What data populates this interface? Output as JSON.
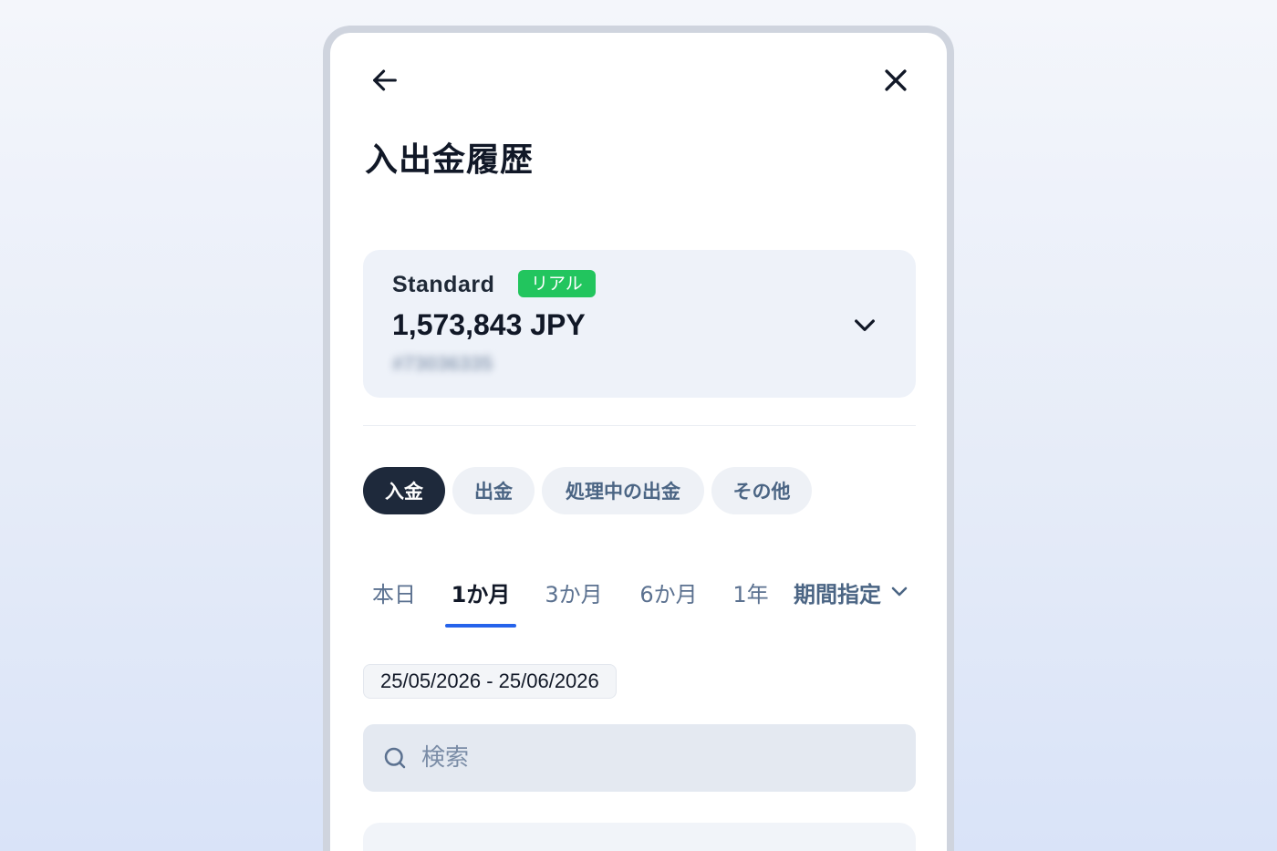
{
  "header": {
    "back_icon": "arrow-left-icon",
    "close_icon": "close-icon",
    "title": "入出金履歴"
  },
  "account": {
    "type": "Standard",
    "badge": "リアル",
    "balance": "1,573,843 JPY",
    "number": "#73036335",
    "badge_color": "#22c55e",
    "chevron_icon": "chevron-down-icon"
  },
  "filters": {
    "chips": [
      {
        "label": "入金",
        "active": true
      },
      {
        "label": "出金",
        "active": false
      },
      {
        "label": "処理中の出金",
        "active": false
      },
      {
        "label": "その他",
        "active": false
      }
    ]
  },
  "periods": {
    "tabs": [
      {
        "label": "本日",
        "active": false
      },
      {
        "label": "1か月",
        "active": true
      },
      {
        "label": "3か月",
        "active": false
      },
      {
        "label": "6か月",
        "active": false
      },
      {
        "label": "1年",
        "active": false
      }
    ],
    "custom_label": "期間指定",
    "accent_color": "#2563eb"
  },
  "date_range": "25/05/2026 - 25/06/2026",
  "search": {
    "placeholder": "検索",
    "icon": "search-icon"
  }
}
